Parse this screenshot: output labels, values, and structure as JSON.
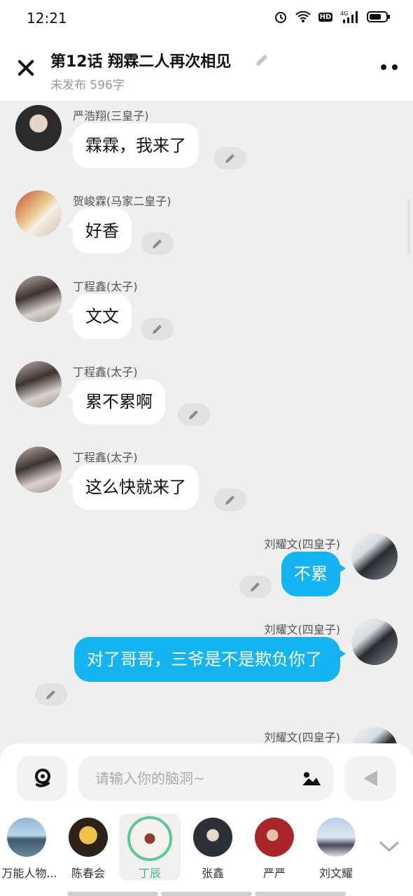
{
  "status_bar": {
    "time": "12:21",
    "network": "4G",
    "hd": "HD"
  },
  "header": {
    "title": "第12话  翔霖二人再次相见",
    "subtitle": "未发布 596字"
  },
  "messages": [
    {
      "side": "left",
      "sender": "严浩翔(三皇子)",
      "text": "霖霖，我来了"
    },
    {
      "side": "left",
      "sender": "贺峻霖(马家二皇子)",
      "text": "好香"
    },
    {
      "side": "left",
      "sender": "丁程鑫(太子)",
      "text": "文文"
    },
    {
      "side": "left",
      "sender": "丁程鑫(太子)",
      "text": "累不累啊"
    },
    {
      "side": "left",
      "sender": "丁程鑫(太子)",
      "text": "这么快就来了"
    },
    {
      "side": "right",
      "sender": "刘耀文(四皇子)",
      "text": "不累"
    },
    {
      "side": "right",
      "sender": "刘耀文(四皇子)",
      "text": "对了哥哥，三爷是不是欺负你了"
    },
    {
      "side": "right",
      "sender": "刘耀文(四皇子)",
      "text": ""
    }
  ],
  "composer": {
    "placeholder": "请输入你的脑洞~"
  },
  "characters": [
    {
      "name": "万能人物...",
      "selected": false
    },
    {
      "name": "陈春会",
      "selected": false
    },
    {
      "name": "丁辰",
      "selected": true
    },
    {
      "name": "张鑫",
      "selected": false
    },
    {
      "name": "严严",
      "selected": false
    },
    {
      "name": "刘文耀",
      "selected": false
    }
  ],
  "colors": {
    "accent_blue": "#14b4f0",
    "selected_green": "#5bc89a",
    "chat_bg": "#efefef"
  }
}
